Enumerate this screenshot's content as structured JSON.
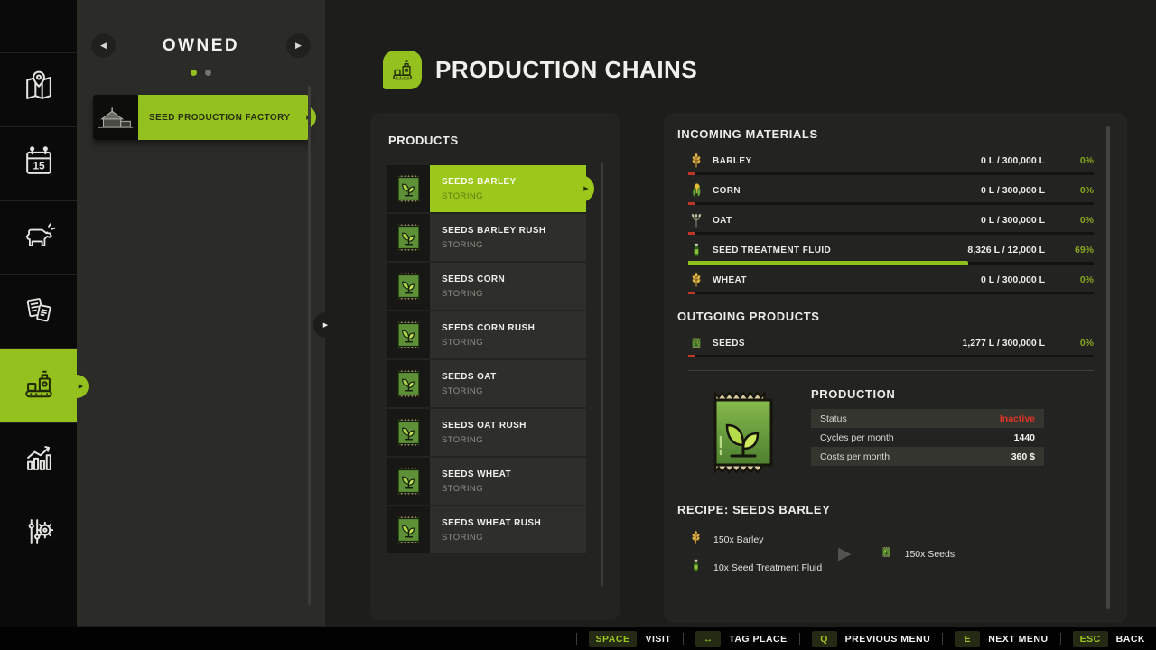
{
  "icons": {
    "chevron_left": "◀",
    "chevron_right": "▶",
    "bump_arrow": "▶",
    "recipe_arrow": "▶"
  },
  "sidebar": {
    "items": [
      {
        "icon": "map"
      },
      {
        "icon": "calendar"
      },
      {
        "icon": "animals"
      },
      {
        "icon": "contracts"
      },
      {
        "icon": "production",
        "active": true
      },
      {
        "icon": "statistics"
      },
      {
        "icon": "settings"
      }
    ]
  },
  "owned_panel": {
    "title": "OWNED",
    "buildings": [
      {
        "name": "SEED PRODUCTION FACTORY",
        "thumb": "factory-photo",
        "selected": true
      }
    ]
  },
  "page": {
    "title": "PRODUCTION CHAINS",
    "icon": "production"
  },
  "products": {
    "title": "PRODUCTS",
    "items": [
      {
        "icon": "seed-packet",
        "name": "SEEDS BARLEY",
        "state": "STORING",
        "selected": true
      },
      {
        "icon": "seed-packet",
        "name": "SEEDS BARLEY RUSH",
        "state": "STORING"
      },
      {
        "icon": "seed-packet",
        "name": "SEEDS CORN",
        "state": "STORING"
      },
      {
        "icon": "seed-packet",
        "name": "SEEDS CORN RUSH",
        "state": "STORING"
      },
      {
        "icon": "seed-packet",
        "name": "SEEDS OAT",
        "state": "STORING"
      },
      {
        "icon": "seed-packet",
        "name": "SEEDS OAT RUSH",
        "state": "STORING"
      },
      {
        "icon": "seed-packet",
        "name": "SEEDS WHEAT",
        "state": "STORING"
      },
      {
        "icon": "seed-packet",
        "name": "SEEDS WHEAT RUSH",
        "state": "STORING"
      }
    ]
  },
  "incoming": {
    "title": "INCOMING MATERIALS",
    "rows": [
      {
        "icon": "barley",
        "name": "BARLEY",
        "value": "0 L / 300,000 L",
        "percent": "0%",
        "fill": 0
      },
      {
        "icon": "corn",
        "name": "CORN",
        "value": "0 L / 300,000 L",
        "percent": "0%",
        "fill": 0
      },
      {
        "icon": "oat",
        "name": "OAT",
        "value": "0 L / 300,000 L",
        "percent": "0%",
        "fill": 0
      },
      {
        "icon": "fluid",
        "name": "SEED TREATMENT FLUID",
        "value": "8,326 L / 12,000 L",
        "percent": "69%",
        "fill": 69
      },
      {
        "icon": "wheat",
        "name": "WHEAT",
        "value": "0 L / 300,000 L",
        "percent": "0%",
        "fill": 0
      }
    ]
  },
  "outgoing": {
    "title": "OUTGOING PRODUCTS",
    "rows": [
      {
        "icon": "seeds",
        "name": "SEEDS",
        "value": "1,277 L / 300,000 L",
        "percent": "0%",
        "fill": 0
      }
    ]
  },
  "production": {
    "title": "PRODUCTION",
    "rows": [
      {
        "label": "Status",
        "value": "Inactive",
        "alt": true,
        "danger": true
      },
      {
        "label": "Cycles per month",
        "value": "1440"
      },
      {
        "label": "Costs per month",
        "value": "360 $",
        "alt": true
      }
    ]
  },
  "recipe": {
    "title": "RECIPE: SEEDS BARLEY",
    "inputs": [
      {
        "icon": "barley",
        "text": "150x Barley"
      },
      {
        "icon": "fluid",
        "text": "10x Seed Treatment Fluid"
      }
    ],
    "output": {
      "icon": "seeds",
      "text": "150x Seeds"
    }
  },
  "keybinds": [
    {
      "key": "SPACE",
      "label": "VISIT"
    },
    {
      "key": "↔",
      "label": "TAG PLACE"
    },
    {
      "key": "Q",
      "label": "PREVIOUS MENU"
    },
    {
      "key": "E",
      "label": "NEXT MENU"
    },
    {
      "key": "ESC",
      "label": "BACK"
    }
  ],
  "colors": {
    "accent": "#95c11f",
    "percent_green": "#87a61f",
    "inactive_red": "#e03428",
    "bar_red": "#bf3527"
  }
}
